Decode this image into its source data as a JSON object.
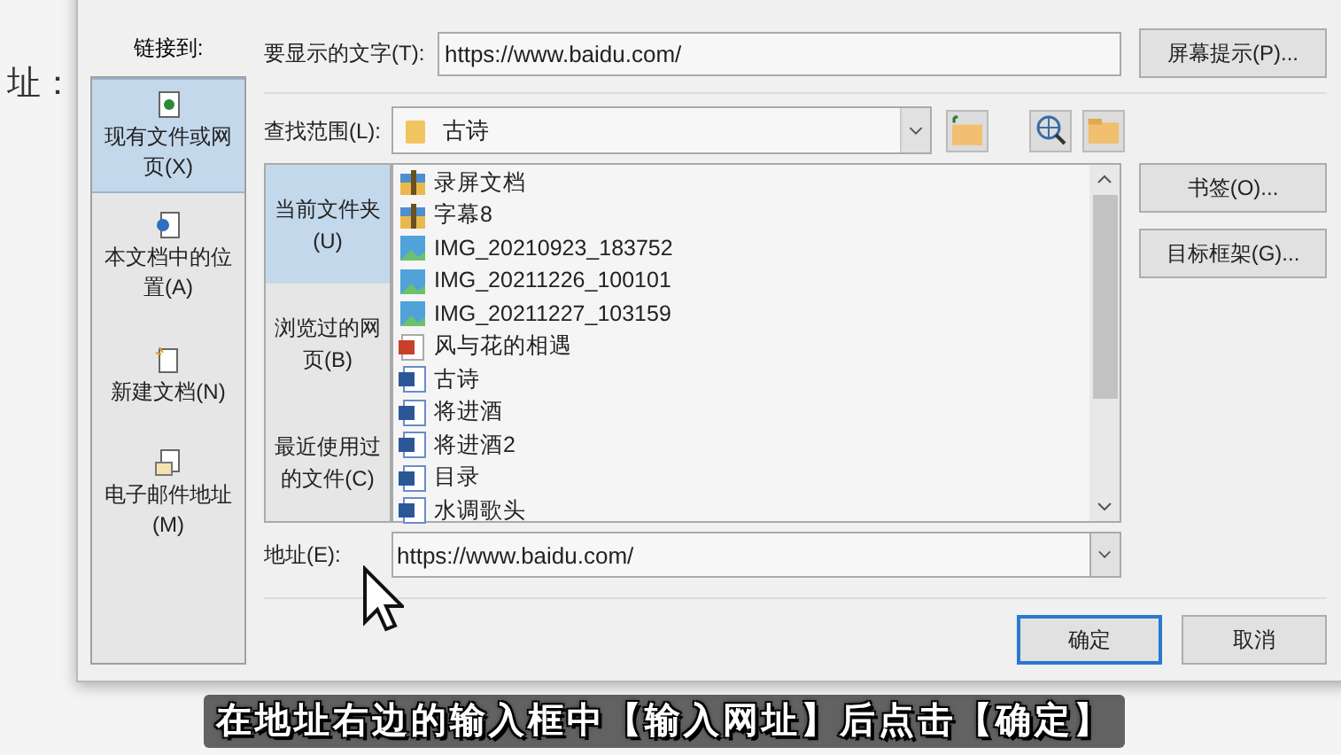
{
  "document": {
    "text": "址："
  },
  "sidebar": {
    "label": "链接到:",
    "items": [
      {
        "label": "现有文件或网页(X)",
        "kind": "web",
        "selected": true
      },
      {
        "label": "本文档中的位置(A)",
        "kind": "place",
        "selected": false
      },
      {
        "label": "新建文档(N)",
        "kind": "new",
        "selected": false
      },
      {
        "label": "电子邮件地址(M)",
        "kind": "mail",
        "selected": false
      }
    ]
  },
  "display_text": {
    "label": "要显示的文字(T):",
    "value": "https://www.baidu.com/"
  },
  "screentip_button": "屏幕提示(P)...",
  "look_in": {
    "label": "查找范围(L):",
    "value": "古诗"
  },
  "browse_tabs": [
    {
      "label": "当前文件夹(U)",
      "selected": true
    },
    {
      "label": "浏览过的网页(B)",
      "selected": false
    },
    {
      "label": "最近使用过的文件(C)",
      "selected": false
    }
  ],
  "files": [
    {
      "name": "录屏文档",
      "kind": "folder"
    },
    {
      "name": "字幕8",
      "kind": "folder"
    },
    {
      "name": "IMG_20210923_183752",
      "kind": "image"
    },
    {
      "name": "IMG_20211226_100101",
      "kind": "image"
    },
    {
      "name": "IMG_20211227_103159",
      "kind": "image"
    },
    {
      "name": "风与花的相遇",
      "kind": "pdf"
    },
    {
      "name": "古诗",
      "kind": "word"
    },
    {
      "name": "将进酒",
      "kind": "word"
    },
    {
      "name": "将进酒2",
      "kind": "word"
    },
    {
      "name": "目录",
      "kind": "word"
    },
    {
      "name": "水调歌头",
      "kind": "word"
    }
  ],
  "side_buttons": [
    "书签(O)...",
    "目标框架(G)..."
  ],
  "address": {
    "label": "地址(E):",
    "value": "https://www.baidu.com/"
  },
  "buttons": [
    {
      "label": "确定",
      "kind": "default"
    },
    {
      "label": "取消",
      "kind": "normal"
    }
  ],
  "subtitle": "在地址右边的输入框中【输入网址】后点击【确定】"
}
